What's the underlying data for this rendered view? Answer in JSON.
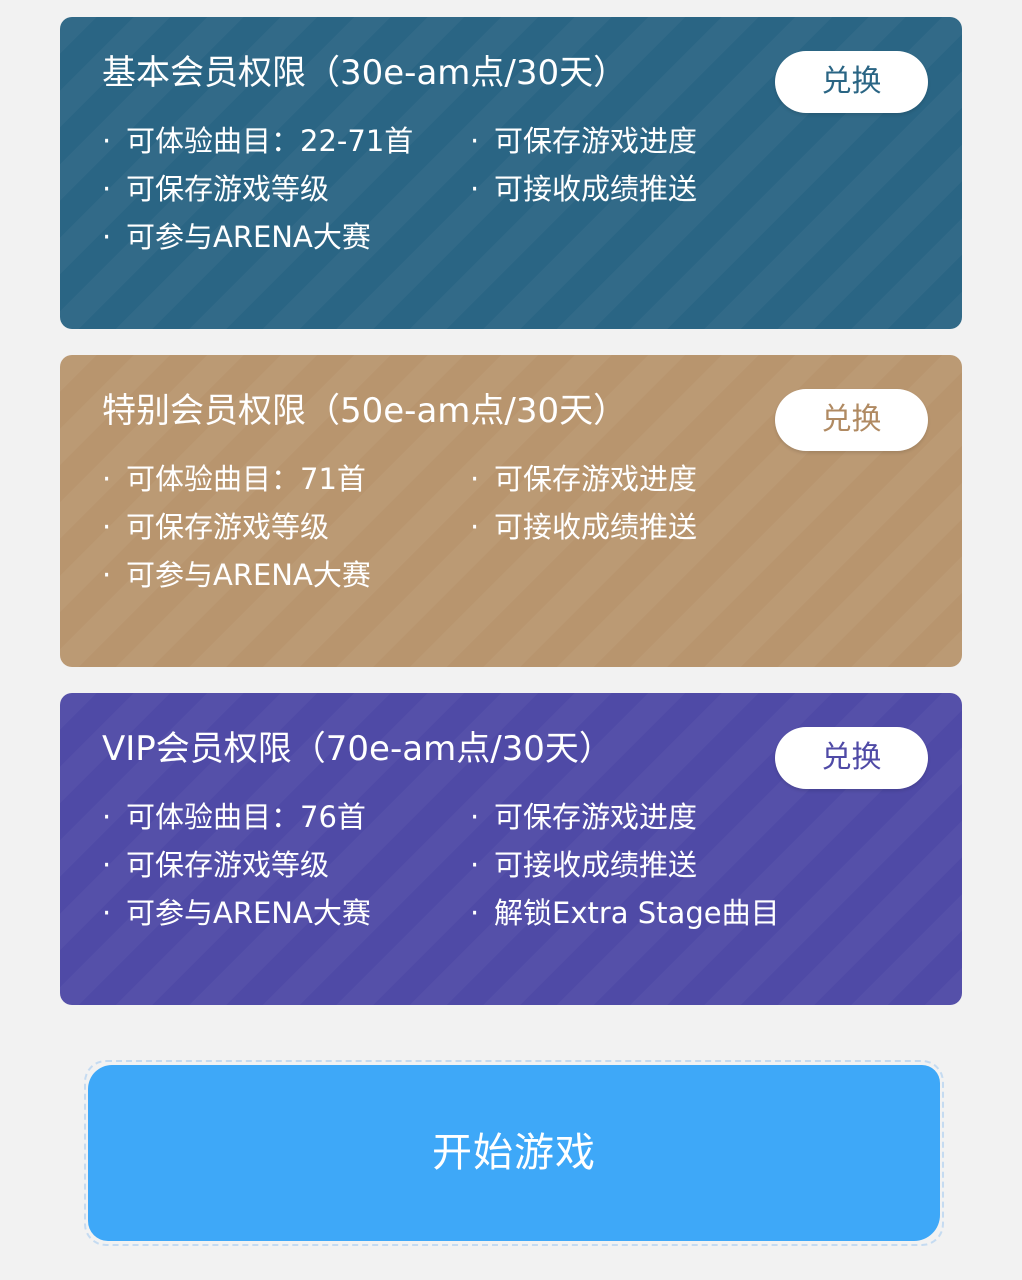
{
  "cards": [
    {
      "title": "基本会员权限（30e-am点/30天）",
      "button_label": "兑换",
      "color": "#2a6584",
      "features_left": [
        "可体验曲目：22-71首",
        "可保存游戏等级",
        "可参与ARENA大赛"
      ],
      "features_right": [
        "可保存游戏进度",
        "可接收成绩推送"
      ]
    },
    {
      "title": "特别会员权限（50e-am点/30天）",
      "button_label": "兑换",
      "color": "#b8956e",
      "features_left": [
        "可体验曲目：71首",
        "可保存游戏等级",
        "可参与ARENA大赛"
      ],
      "features_right": [
        "可保存游戏进度",
        "可接收成绩推送"
      ]
    },
    {
      "title": "VIP会员权限（70e-am点/30天）",
      "button_label": "兑换",
      "color": "#4f4aa6",
      "features_left": [
        "可体验曲目：76首",
        "可保存游戏等级",
        "可参与ARENA大赛"
      ],
      "features_right": [
        "可保存游戏进度",
        "可接收成绩推送",
        "解锁Extra Stage曲目"
      ]
    }
  ],
  "bullet": "·",
  "start_button": {
    "label": "开始游戏",
    "color": "#3ea8f8"
  }
}
